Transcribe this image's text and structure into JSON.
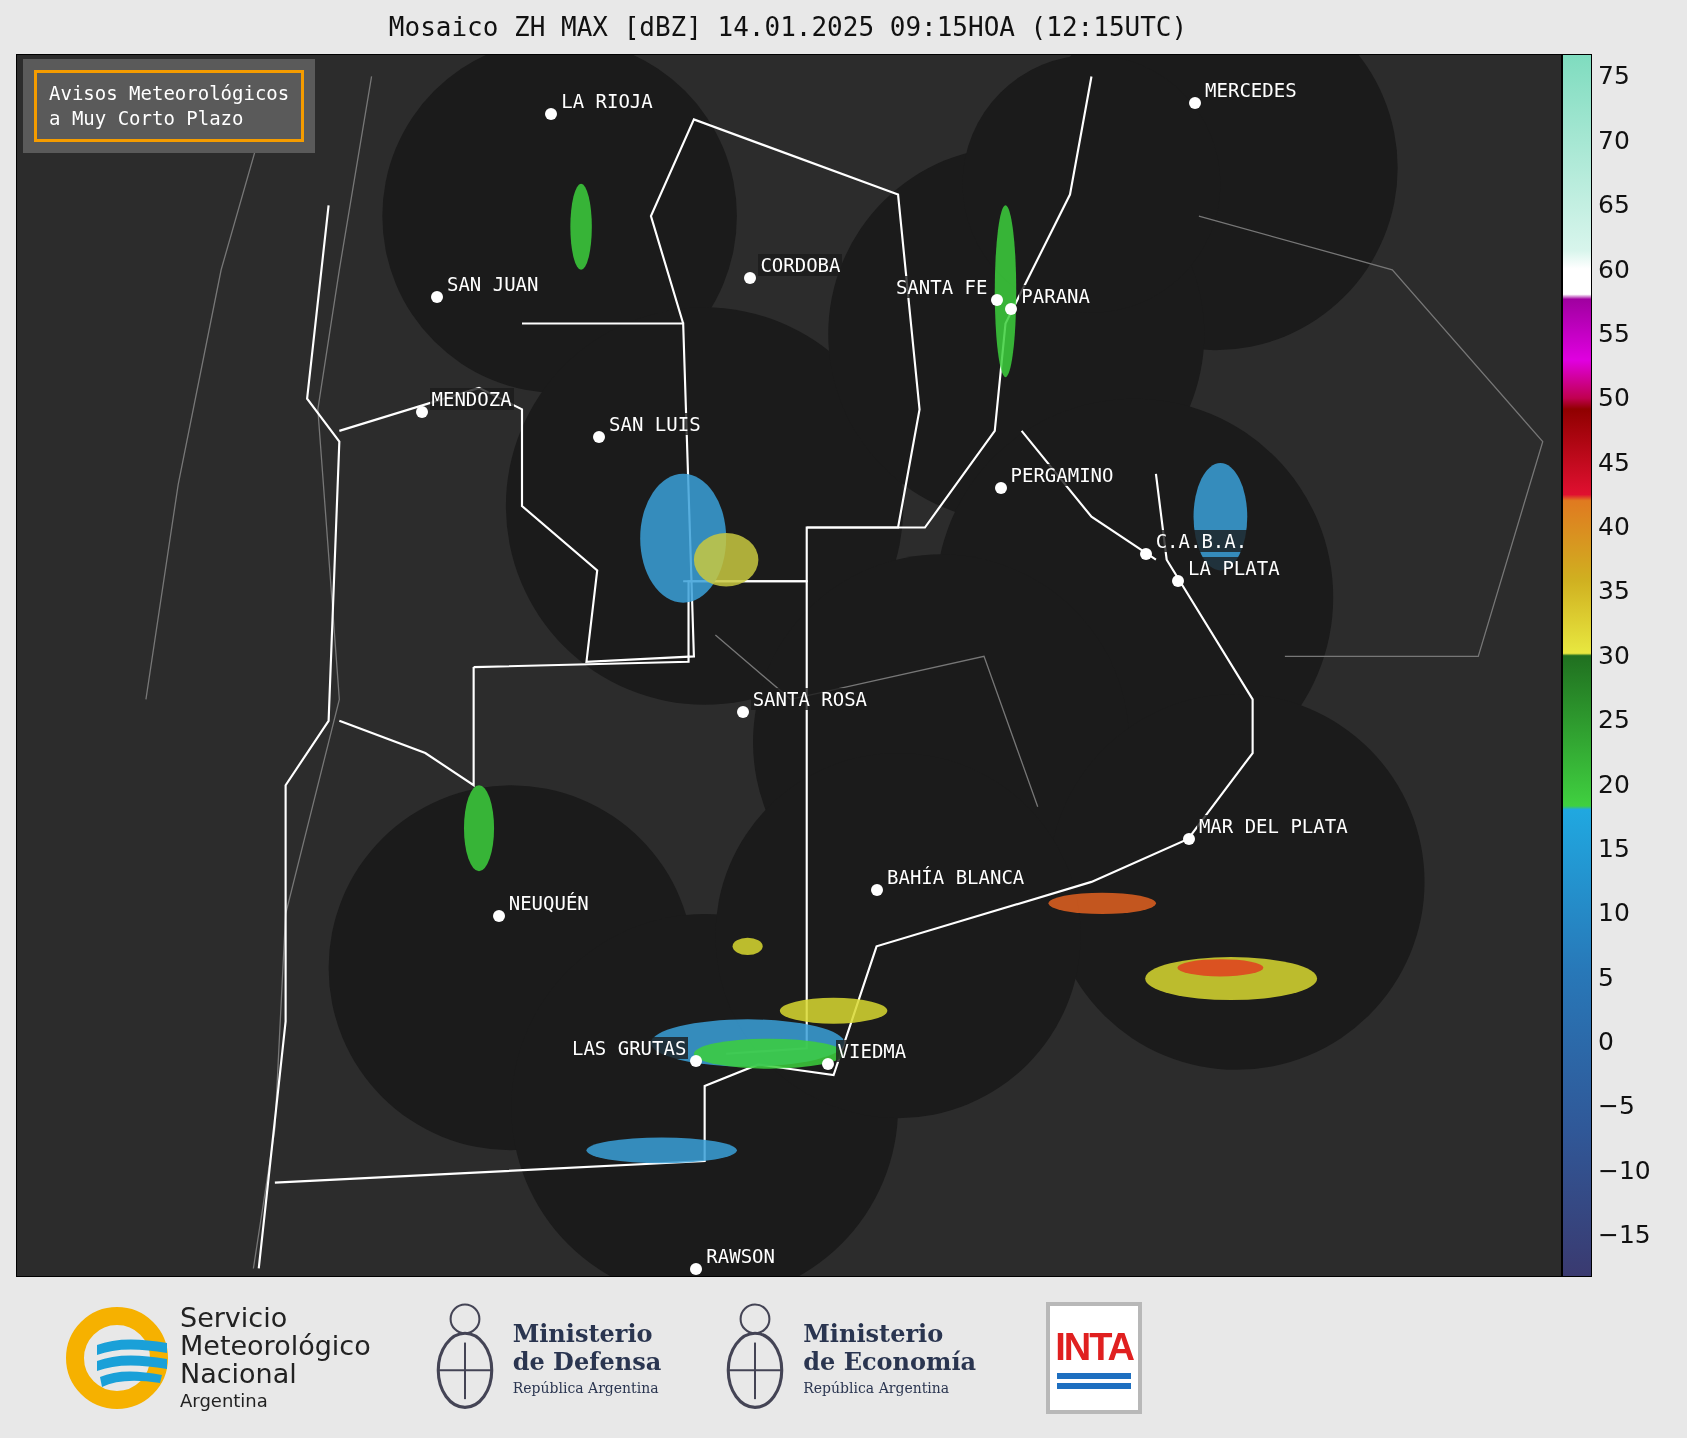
{
  "title": "Mosaico ZH MAX [dBZ] 14.01.2025 09:15HOA (12:15UTC)",
  "alert_box": {
    "lines": [
      "Avisos Meteorológicos",
      "a Muy Corto Plazo"
    ]
  },
  "cities": [
    {
      "name": "LA RIOJA"
    },
    {
      "name": "MERCEDES"
    },
    {
      "name": "CORDOBA"
    },
    {
      "name": "SAN JUAN"
    },
    {
      "name": "SANTA FE"
    },
    {
      "name": "PARANA"
    },
    {
      "name": "MENDOZA"
    },
    {
      "name": "SAN LUIS"
    },
    {
      "name": "PERGAMINO"
    },
    {
      "name": "C.A.B.A."
    },
    {
      "name": "LA PLATA"
    },
    {
      "name": "SANTA ROSA"
    },
    {
      "name": "MAR DEL PLATA"
    },
    {
      "name": "BAHÍA BLANCA"
    },
    {
      "name": "NEUQUÉN"
    },
    {
      "name": "LAS GRUTAS"
    },
    {
      "name": "VIEDMA"
    },
    {
      "name": "RAWSON"
    }
  ],
  "colorbar": {
    "ticks": [
      "75",
      "70",
      "65",
      "60",
      "55",
      "50",
      "45",
      "40",
      "35",
      "30",
      "25",
      "20",
      "15",
      "10",
      "5",
      "0",
      "−5",
      "−10",
      "−15"
    ]
  },
  "footer": {
    "smn": {
      "lines": [
        "Servicio",
        "Meteorológico",
        "Nacional"
      ],
      "country": "Argentina"
    },
    "ministries": [
      {
        "name": "Ministerio",
        "sub": "de Defensa",
        "country": "República Argentina"
      },
      {
        "name": "Ministerio",
        "sub": "de Economía",
        "country": "República Argentina"
      }
    ],
    "inta": "INTA"
  }
}
